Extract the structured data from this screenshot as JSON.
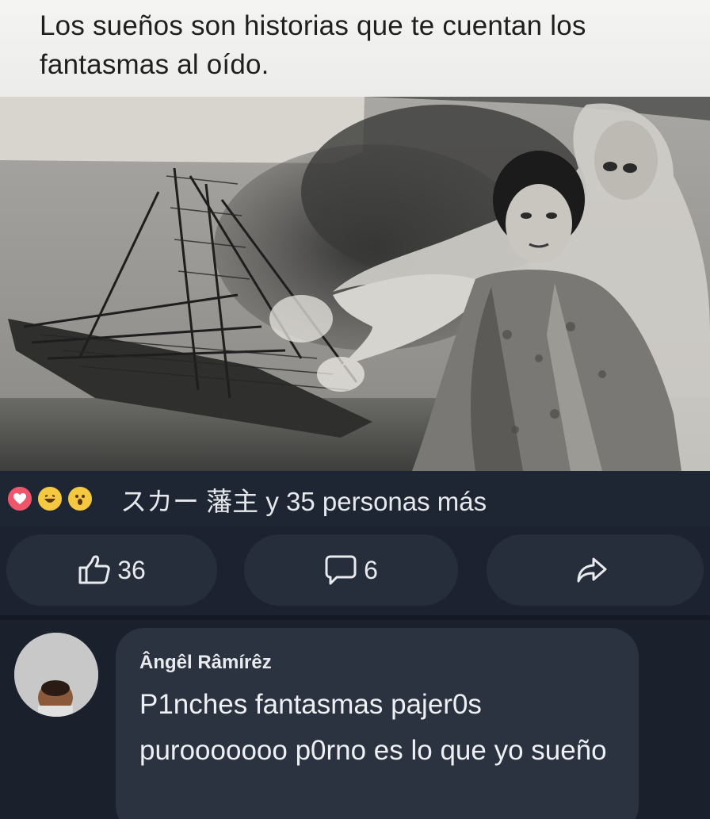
{
  "post": {
    "caption": "Los sueños son historias que te cuentan los fantasmas al oído."
  },
  "photo": {
    "icon": "vintage-illustration-woman-ghost-burning-ship"
  },
  "reactions": {
    "icons": [
      "heart-reaction-icon",
      "haha-reaction-icon",
      "wow-reaction-icon"
    ],
    "summary": "スカー 藩主 y 35 personas más"
  },
  "actions": {
    "like_count": "36",
    "comment_count": "6"
  },
  "comment": {
    "author": "Ângêl Râmírêz",
    "text": "P1nches fantasmas pajer0s purooooooo p0rno es lo que yo sueño"
  },
  "colors": {
    "dark_bg": "#1c2230",
    "button_bg": "#262d3b",
    "bubble_bg": "#2b3240",
    "love": "#f0566b",
    "haha": "#f5c842"
  }
}
